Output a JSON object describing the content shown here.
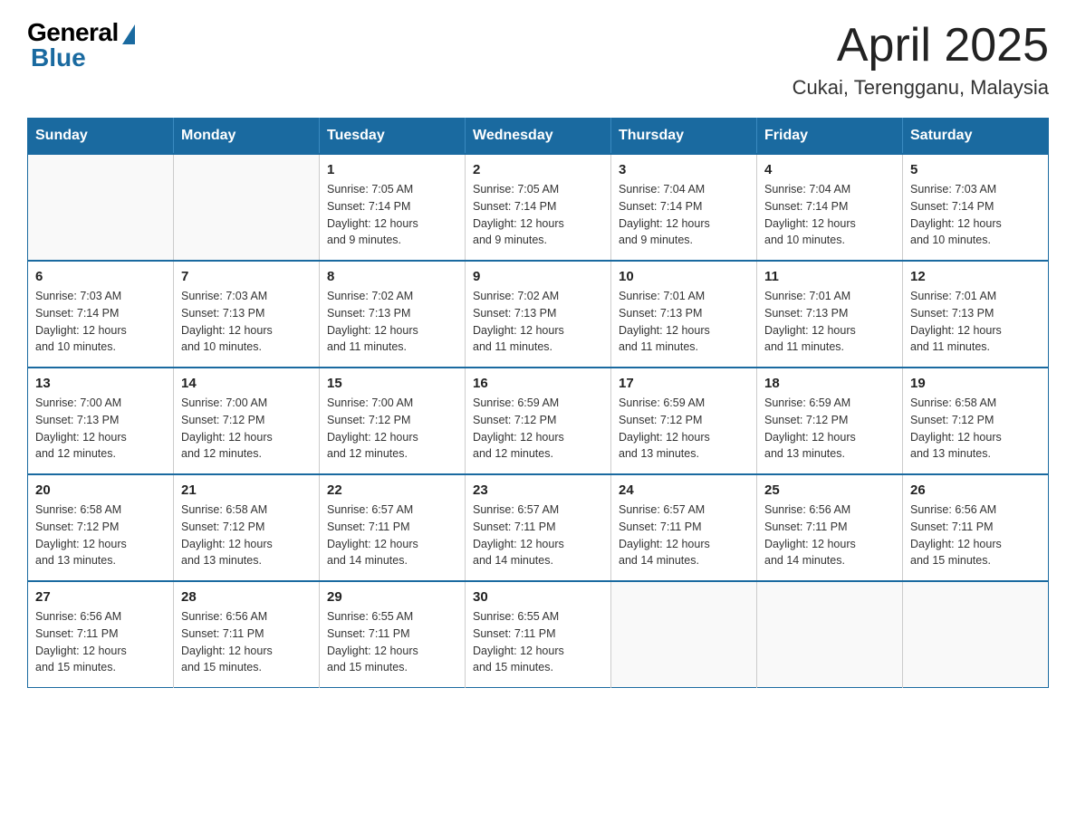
{
  "header": {
    "logo_general": "General",
    "logo_blue": "Blue",
    "main_title": "April 2025",
    "subtitle": "Cukai, Terengganu, Malaysia"
  },
  "calendar": {
    "days_of_week": [
      "Sunday",
      "Monday",
      "Tuesday",
      "Wednesday",
      "Thursday",
      "Friday",
      "Saturday"
    ],
    "weeks": [
      [
        {
          "day": "",
          "info": ""
        },
        {
          "day": "",
          "info": ""
        },
        {
          "day": "1",
          "info": "Sunrise: 7:05 AM\nSunset: 7:14 PM\nDaylight: 12 hours\nand 9 minutes."
        },
        {
          "day": "2",
          "info": "Sunrise: 7:05 AM\nSunset: 7:14 PM\nDaylight: 12 hours\nand 9 minutes."
        },
        {
          "day": "3",
          "info": "Sunrise: 7:04 AM\nSunset: 7:14 PM\nDaylight: 12 hours\nand 9 minutes."
        },
        {
          "day": "4",
          "info": "Sunrise: 7:04 AM\nSunset: 7:14 PM\nDaylight: 12 hours\nand 10 minutes."
        },
        {
          "day": "5",
          "info": "Sunrise: 7:03 AM\nSunset: 7:14 PM\nDaylight: 12 hours\nand 10 minutes."
        }
      ],
      [
        {
          "day": "6",
          "info": "Sunrise: 7:03 AM\nSunset: 7:14 PM\nDaylight: 12 hours\nand 10 minutes."
        },
        {
          "day": "7",
          "info": "Sunrise: 7:03 AM\nSunset: 7:13 PM\nDaylight: 12 hours\nand 10 minutes."
        },
        {
          "day": "8",
          "info": "Sunrise: 7:02 AM\nSunset: 7:13 PM\nDaylight: 12 hours\nand 11 minutes."
        },
        {
          "day": "9",
          "info": "Sunrise: 7:02 AM\nSunset: 7:13 PM\nDaylight: 12 hours\nand 11 minutes."
        },
        {
          "day": "10",
          "info": "Sunrise: 7:01 AM\nSunset: 7:13 PM\nDaylight: 12 hours\nand 11 minutes."
        },
        {
          "day": "11",
          "info": "Sunrise: 7:01 AM\nSunset: 7:13 PM\nDaylight: 12 hours\nand 11 minutes."
        },
        {
          "day": "12",
          "info": "Sunrise: 7:01 AM\nSunset: 7:13 PM\nDaylight: 12 hours\nand 11 minutes."
        }
      ],
      [
        {
          "day": "13",
          "info": "Sunrise: 7:00 AM\nSunset: 7:13 PM\nDaylight: 12 hours\nand 12 minutes."
        },
        {
          "day": "14",
          "info": "Sunrise: 7:00 AM\nSunset: 7:12 PM\nDaylight: 12 hours\nand 12 minutes."
        },
        {
          "day": "15",
          "info": "Sunrise: 7:00 AM\nSunset: 7:12 PM\nDaylight: 12 hours\nand 12 minutes."
        },
        {
          "day": "16",
          "info": "Sunrise: 6:59 AM\nSunset: 7:12 PM\nDaylight: 12 hours\nand 12 minutes."
        },
        {
          "day": "17",
          "info": "Sunrise: 6:59 AM\nSunset: 7:12 PM\nDaylight: 12 hours\nand 13 minutes."
        },
        {
          "day": "18",
          "info": "Sunrise: 6:59 AM\nSunset: 7:12 PM\nDaylight: 12 hours\nand 13 minutes."
        },
        {
          "day": "19",
          "info": "Sunrise: 6:58 AM\nSunset: 7:12 PM\nDaylight: 12 hours\nand 13 minutes."
        }
      ],
      [
        {
          "day": "20",
          "info": "Sunrise: 6:58 AM\nSunset: 7:12 PM\nDaylight: 12 hours\nand 13 minutes."
        },
        {
          "day": "21",
          "info": "Sunrise: 6:58 AM\nSunset: 7:12 PM\nDaylight: 12 hours\nand 13 minutes."
        },
        {
          "day": "22",
          "info": "Sunrise: 6:57 AM\nSunset: 7:11 PM\nDaylight: 12 hours\nand 14 minutes."
        },
        {
          "day": "23",
          "info": "Sunrise: 6:57 AM\nSunset: 7:11 PM\nDaylight: 12 hours\nand 14 minutes."
        },
        {
          "day": "24",
          "info": "Sunrise: 6:57 AM\nSunset: 7:11 PM\nDaylight: 12 hours\nand 14 minutes."
        },
        {
          "day": "25",
          "info": "Sunrise: 6:56 AM\nSunset: 7:11 PM\nDaylight: 12 hours\nand 14 minutes."
        },
        {
          "day": "26",
          "info": "Sunrise: 6:56 AM\nSunset: 7:11 PM\nDaylight: 12 hours\nand 15 minutes."
        }
      ],
      [
        {
          "day": "27",
          "info": "Sunrise: 6:56 AM\nSunset: 7:11 PM\nDaylight: 12 hours\nand 15 minutes."
        },
        {
          "day": "28",
          "info": "Sunrise: 6:56 AM\nSunset: 7:11 PM\nDaylight: 12 hours\nand 15 minutes."
        },
        {
          "day": "29",
          "info": "Sunrise: 6:55 AM\nSunset: 7:11 PM\nDaylight: 12 hours\nand 15 minutes."
        },
        {
          "day": "30",
          "info": "Sunrise: 6:55 AM\nSunset: 7:11 PM\nDaylight: 12 hours\nand 15 minutes."
        },
        {
          "day": "",
          "info": ""
        },
        {
          "day": "",
          "info": ""
        },
        {
          "day": "",
          "info": ""
        }
      ]
    ]
  }
}
